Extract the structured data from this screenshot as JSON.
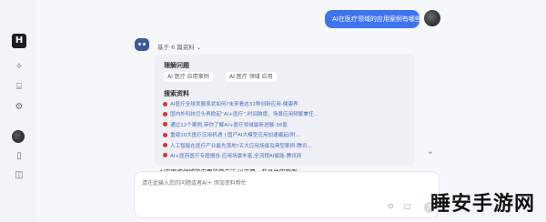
{
  "sidebar": {
    "logo_text": "H",
    "icons": [
      "new-chat-icon",
      "history-icon",
      "settings-icon",
      "mobile-icon",
      "share-icon"
    ]
  },
  "conversation": {
    "user_message": "AI在医疗领域的应用案例有哪些?",
    "source_toggle": "基于 6 篇资料 ⌄"
  },
  "answer_card": {
    "understand_title": "理解问题",
    "tags": [
      "AI 医疗 应用案例",
      "AI 医疗 领域 应用"
    ],
    "search_title": "搜索资料",
    "references": [
      "AI医疗全球发展现状如何?未来看这32种创新应用-健康界",
      "国内外科技巨头再掀起“AI+医疗”,时间跨度、场景应用频繁兼任…",
      "通过12个案例,带你了解AI+医疗领域最新进展-36氪",
      "重磅10大医疗应用机遇 | 国产AI大模型应用加速崛起(附…",
      "人工智能在医疗产业最先落地?五大应用场景及典型案例-腾讯…",
      "AI+医药医疗专题报告:应用场景丰富,全流程AI赋能-腾讯网"
    ]
  },
  "answer_preview": "AI在医疗领域的应用非常广泛,以下是一些具体的案例:",
  "input": {
    "placeholder": "请在此输入您的问题或者Ai+ 添加资料帮忙"
  },
  "watermark": "睡安手游网",
  "colors": {
    "accent": "#3f74f0",
    "link": "#4c6fbf",
    "card_bg": "#eef0f6"
  }
}
